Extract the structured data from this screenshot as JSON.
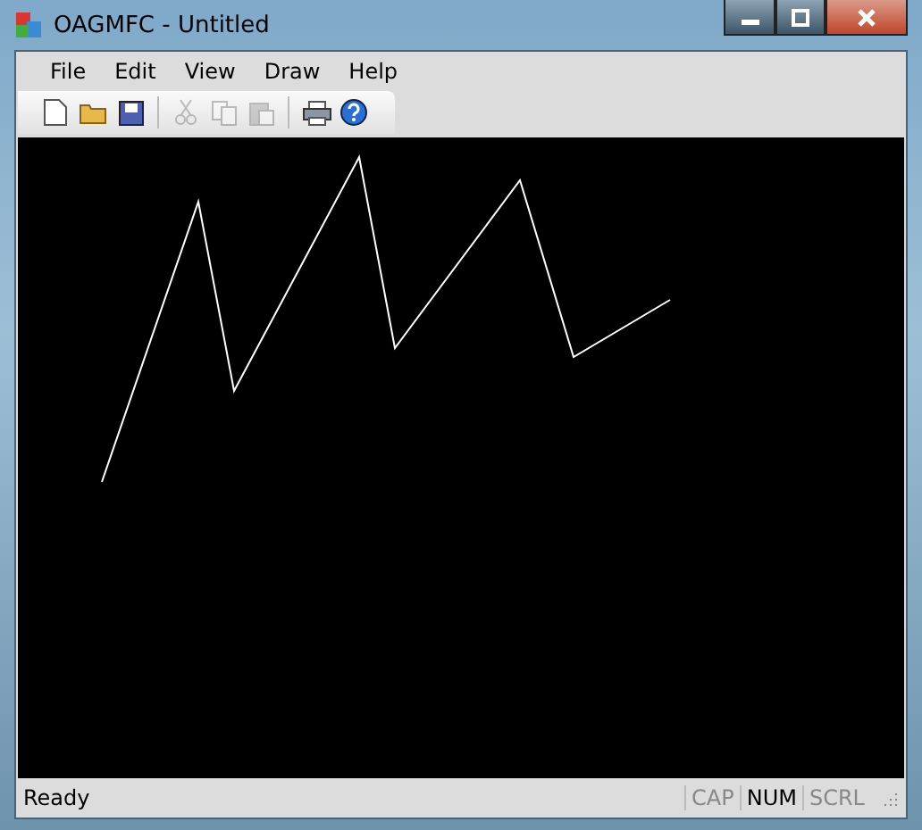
{
  "window": {
    "title": "OAGMFC - Untitled"
  },
  "menu": [
    "File",
    "Edit",
    "View",
    "Draw",
    "Help"
  ],
  "toolbar": [
    {
      "kind": "new",
      "disabled": false
    },
    {
      "kind": "open",
      "disabled": false
    },
    {
      "kind": "save",
      "disabled": false
    },
    {
      "kind": "separator"
    },
    {
      "kind": "cut",
      "disabled": true
    },
    {
      "kind": "copy",
      "disabled": true
    },
    {
      "kind": "paste",
      "disabled": true
    },
    {
      "kind": "separator"
    },
    {
      "kind": "print",
      "disabled": false
    },
    {
      "kind": "help",
      "disabled": false
    }
  ],
  "status_bar": {
    "text": "Ready",
    "indicators": [
      {
        "label": "CAP",
        "on": false
      },
      {
        "label": "NUM",
        "on": true
      },
      {
        "label": "SCRL",
        "on": false
      }
    ]
  }
}
